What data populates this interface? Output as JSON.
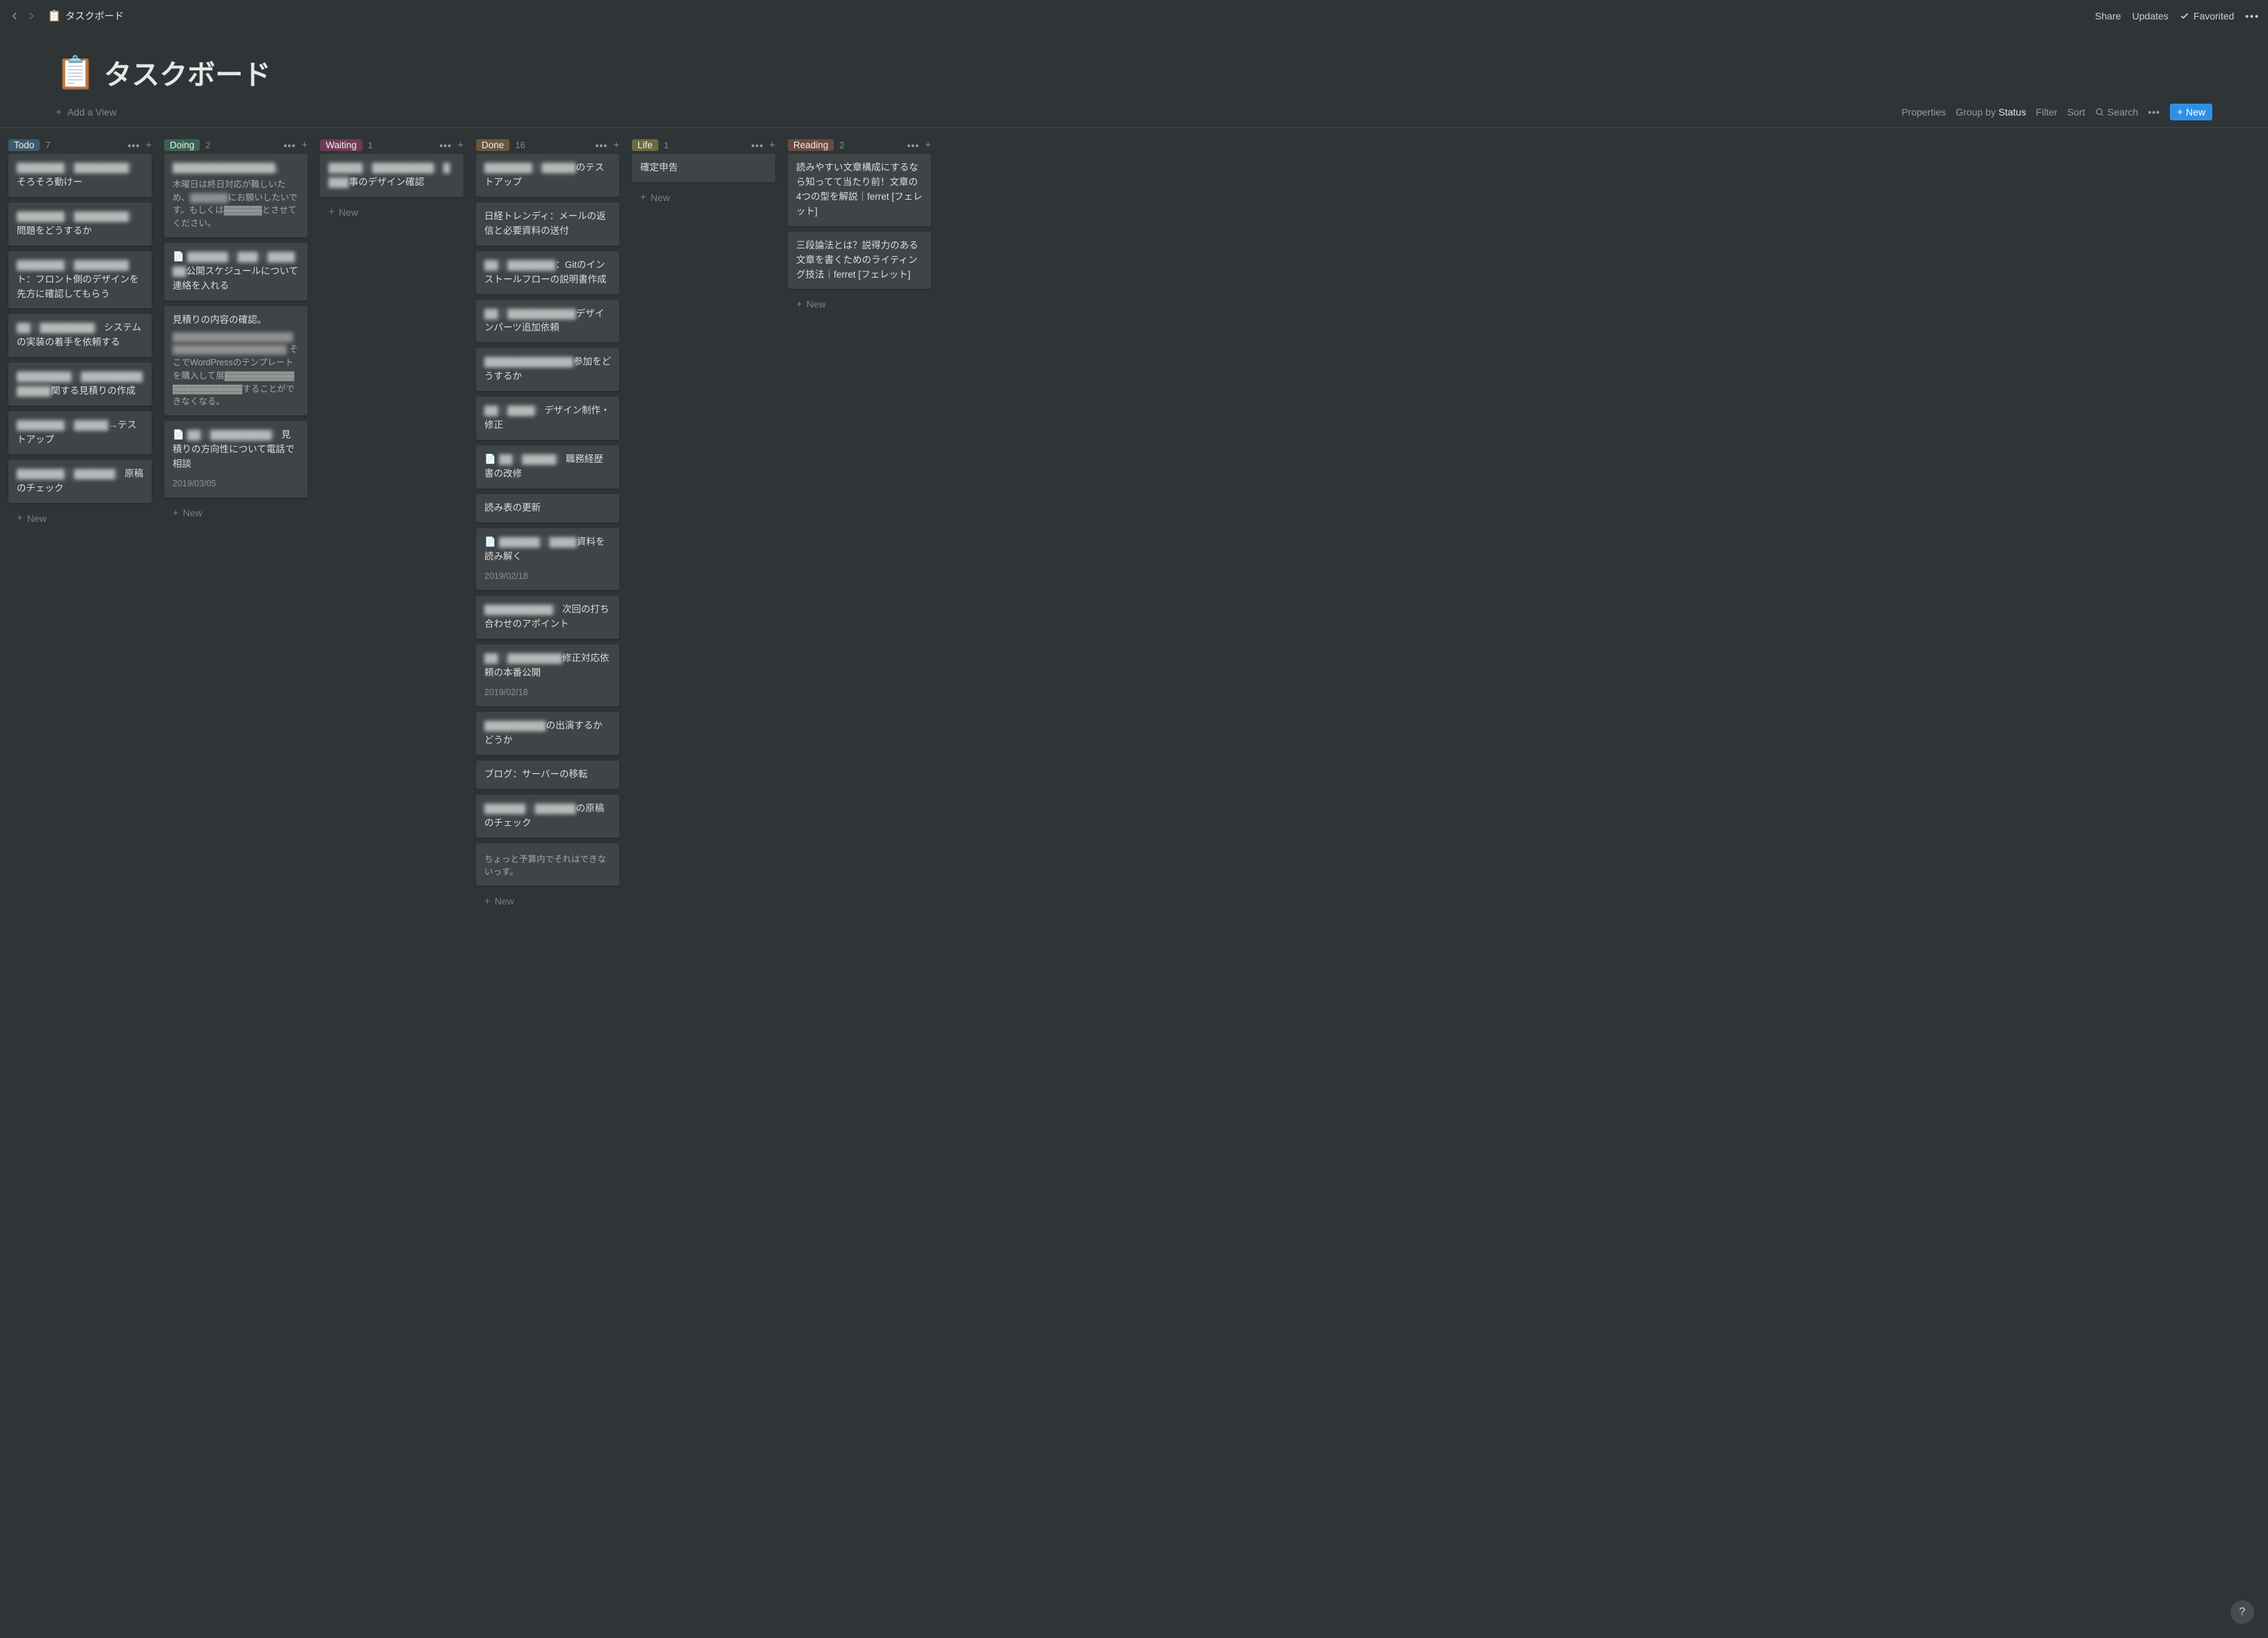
{
  "topbar": {
    "breadcrumb_icon": "📋",
    "breadcrumb_title": "タスクボード",
    "share": "Share",
    "updates": "Updates",
    "favorited": "Favorited"
  },
  "page": {
    "icon": "📋",
    "title": "タスクボード"
  },
  "viewbar": {
    "add_view": "Add a View",
    "properties": "Properties",
    "group_by_prefix": "Group by ",
    "group_by_value": "Status",
    "filter": "Filter",
    "sort": "Sort",
    "search": "Search",
    "new": "New"
  },
  "labels": {
    "new": "New"
  },
  "columns": [
    {
      "name": "Todo",
      "tagClass": "tag-todo",
      "count": 7,
      "cards": [
        {
          "blur": "▓▓▓▓▓▓▓｜▓▓▓▓▓▓▓▓：",
          "text": "そろそろ動けー"
        },
        {
          "blur": "▓▓▓▓▓▓▓｜▓▓▓▓▓▓▓▓：",
          "text": "問題をどうするか"
        },
        {
          "blur": "▓▓▓▓▓▓▓｜▓▓▓▓▓▓▓▓",
          "text": "ト：フロント側のデザインを先方に確認してもらう"
        },
        {
          "blur": "▓▓｜▓▓▓▓▓▓▓▓：",
          "text": "システムの実装の着手を依頼する"
        },
        {
          "blur": "▓▓▓▓▓▓▓▓｜▓▓▓▓▓▓▓▓▓▓▓▓▓▓",
          "text": "関する見積りの作成"
        },
        {
          "blur": "▓▓▓▓▓▓▓｜▓▓▓▓▓",
          "text": "→テストアップ"
        },
        {
          "blur": "▓▓▓▓▓▓▓｜▓▓▓▓▓▓：",
          "text": "原稿のチェック"
        }
      ]
    },
    {
      "name": "Doing",
      "tagClass": "tag-doing",
      "count": 2,
      "cards": [
        {
          "blur": "▓▓▓▓▓▓▓▓▓▓▓▓▓▓▓。",
          "text": "",
          "desc_pre": "木曜日は終日対応が難しいため、",
          "desc_blur": "▓▓▓▓▓▓",
          "desc_post": "にお願いしたいです。もしくは▓▓▓▓▓▓とさせてください。"
        },
        {
          "hasDoc": true,
          "blur": "▓▓▓▓▓▓｜▓▓▓｜▓▓▓▓▓▓",
          "text": "公開スケジュールについて連絡を入れる"
        },
        {
          "text": "見積りの内容の確認。",
          "desc_blur_full": "▓▓▓▓▓▓▓▓▓▓▓▓▓▓▓▓▓▓▓▓▓▓▓▓▓▓▓▓▓▓▓▓▓▓▓▓▓",
          "desc_post2": "そこでWordPressのテンプレートを購入して展▓▓▓▓▓▓▓▓▓▓▓▓▓▓▓▓▓▓▓▓▓▓することができなくなる。"
        },
        {
          "hasDoc": true,
          "blur": "▓▓｜▓▓▓▓▓▓▓▓▓：",
          "text": "見積りの方向性について電話で相談",
          "date": "2019/03/05"
        }
      ]
    },
    {
      "name": "Waiting",
      "tagClass": "tag-waiting",
      "count": 1,
      "cards": [
        {
          "blur": "▓▓▓▓▓｜▓▓▓▓▓▓▓▓▓：▓▓▓▓",
          "text": "事のデザイン確認"
        }
      ]
    },
    {
      "name": "Done",
      "tagClass": "tag-done",
      "count": 16,
      "cards": [
        {
          "blur": "▓▓▓▓▓▓▓｜▓▓▓▓▓",
          "text": "のテストアップ"
        },
        {
          "text": "日経トレンディ：メールの返信と必要資料の送付"
        },
        {
          "blur": "▓▓｜▓▓▓▓▓▓▓",
          "text": "：Gitのインストールフローの説明書作成"
        },
        {
          "blur": "▓▓｜▓▓▓▓▓▓▓▓▓▓",
          "text": "デザインパーツ追加依頼"
        },
        {
          "blur": "▓▓▓▓▓▓▓▓▓▓▓▓▓",
          "text": "参加をどうするか"
        },
        {
          "blur": "▓▓｜▓▓▓▓：",
          "text": "デザイン制作・修正"
        },
        {
          "hasDoc": true,
          "blur": "▓▓｜▓▓▓▓▓：",
          "text": "職務経歴書の改修"
        },
        {
          "text": "読み表の更新"
        },
        {
          "hasDoc": true,
          "blur": "▓▓▓▓▓▓｜▓▓▓▓",
          "text": "資料を読み解く",
          "date": "2019/02/18"
        },
        {
          "blur": "▓▓▓▓▓▓▓▓▓▓：",
          "text": "次回の打ち合わせのアポイント"
        },
        {
          "blur": "▓▓｜▓▓▓▓▓▓▓▓",
          "text": "修正対応依頼の本番公開",
          "date": "2019/02/18"
        },
        {
          "blur": "▓▓▓▓▓▓▓▓▓",
          "text": "の出演するかどうか"
        },
        {
          "text": "ブログ：サーバーの移転"
        },
        {
          "blur": "▓▓▓▓▓▓｜▓▓▓▓▓▓",
          "text": "の原稿のチェック"
        },
        {
          "desc_only": "ちょっと予算内でそれはできないっす。"
        }
      ]
    },
    {
      "name": "Life",
      "tagClass": "tag-life",
      "count": 1,
      "cards": [
        {
          "text": "確定申告"
        }
      ]
    },
    {
      "name": "Reading",
      "tagClass": "tag-reading",
      "count": 2,
      "cards": [
        {
          "text": "読みやすい文章構成にするなら知ってて当たり前！文章の4つの型を解説｜ferret [フェレット]"
        },
        {
          "text": "三段論法とは？説得力のある文章を書くためのライティング技法｜ferret [フェレット]"
        }
      ]
    }
  ]
}
